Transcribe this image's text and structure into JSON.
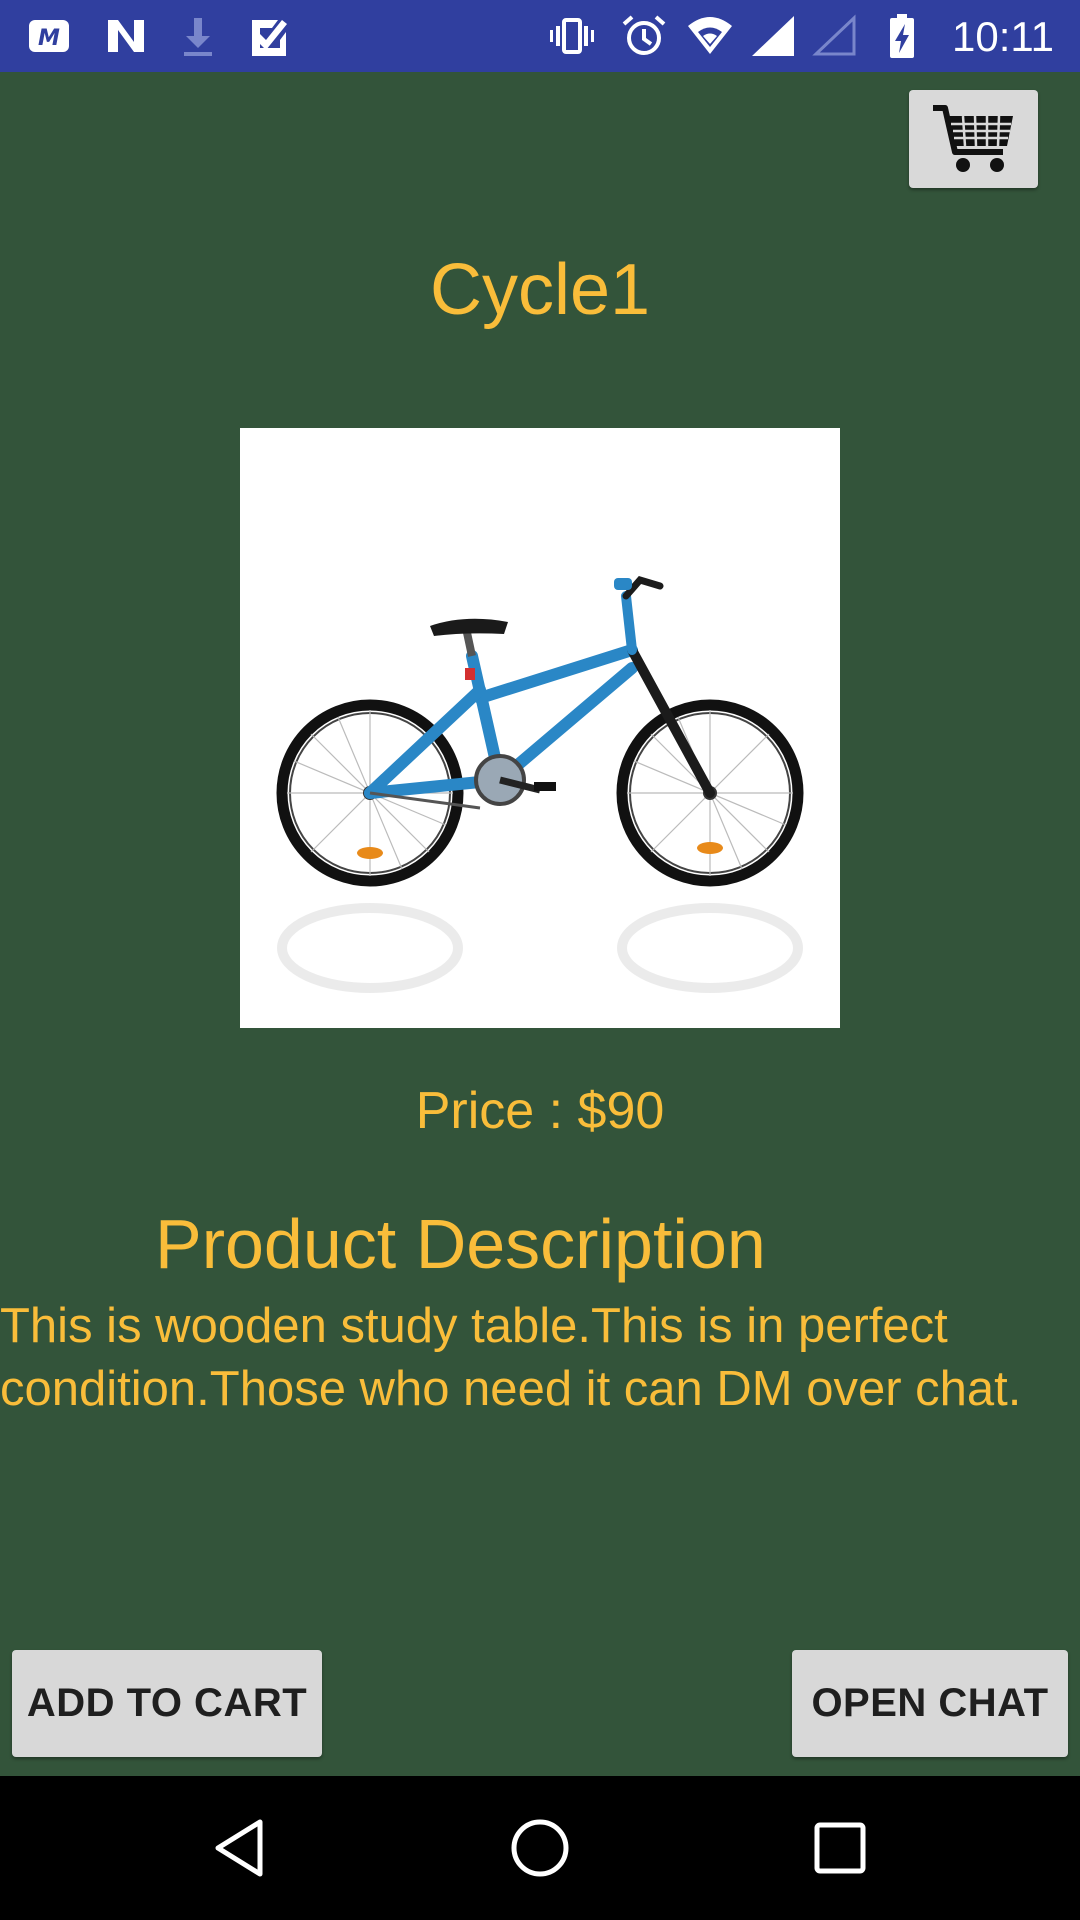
{
  "status_bar": {
    "time": "10:11",
    "left_icons": [
      "motorola-icon",
      "n-icon",
      "download-icon",
      "task-check-icon"
    ],
    "right_icons": [
      "vibrate-icon",
      "alarm-icon",
      "wifi-icon",
      "signal-icon",
      "signal-empty-icon",
      "battery-charging-icon"
    ],
    "background": "#303f9f"
  },
  "header": {
    "cart_icon": "shopping-cart-icon"
  },
  "product": {
    "title": "Cycle1",
    "image": "bicycle-photo",
    "price": "Price : $90",
    "description_heading": "Product Description",
    "description": "This is wooden study table.This is in perfect condition.Those who need it can DM over chat."
  },
  "actions": {
    "add_to_cart_label": "ADD TO CART",
    "open_chat_label": "OPEN CHAT"
  },
  "nav_bar": {
    "icons": [
      "back-icon",
      "home-icon",
      "recents-icon"
    ]
  },
  "colors": {
    "background": "#33543a",
    "accent_text": "#f9bd3a",
    "button": "#d8d8d8",
    "button_text": "#1f1f1f"
  }
}
